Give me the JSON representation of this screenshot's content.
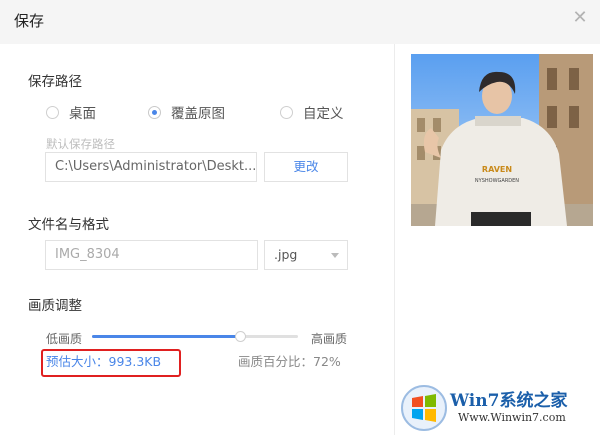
{
  "window": {
    "title": "保存"
  },
  "save_path": {
    "section_label": "保存路径",
    "options": [
      {
        "label": "桌面",
        "checked": false
      },
      {
        "label": "覆盖原图",
        "checked": true
      },
      {
        "label": "自定义",
        "checked": false
      }
    ],
    "hint": "默认保存路径",
    "path_value": "C:\\Users\\Administrator\\Deskt...",
    "change_label": "更改"
  },
  "file": {
    "section_label": "文件名与格式",
    "name_value": "IMG_8304",
    "format_value": ".jpg"
  },
  "quality": {
    "section_label": "画质调整",
    "low_label": "低画质",
    "high_label": "高画质",
    "percent": 72,
    "estimate_text": "预估大小：993.3KB",
    "percent_text": "画质百分比：72%"
  },
  "preview": {
    "jacket_text": "NYSHOWGARDEN"
  },
  "watermark": {
    "brand": "Win7系统之家",
    "url": "Www.Winwin7.com"
  },
  "colors": {
    "accent": "#4a86e8",
    "highlight": "#e02020"
  }
}
